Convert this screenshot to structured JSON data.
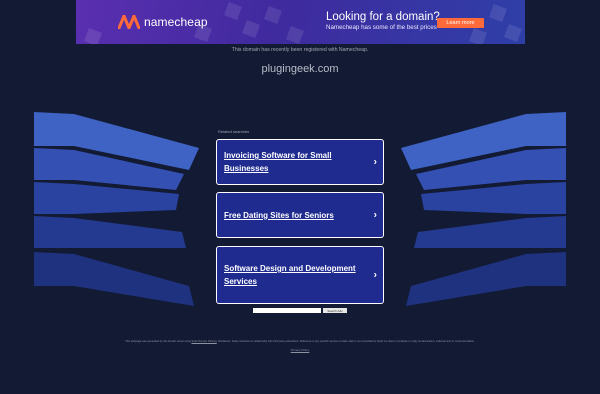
{
  "banner": {
    "brand": "namecheap",
    "title": "Looking for a domain?",
    "subtitle": "Namecheap has some of the best prices",
    "button_label": "Learn more",
    "brand_color": "#ff6a3a"
  },
  "notice": "This domain has recently been registered with Namecheap.",
  "domain": "plugingeek.com",
  "related_label": "Related searches",
  "searches": [
    {
      "label": "Invoicing Software for Small Businesses"
    },
    {
      "label": "Free Dating Sites for Seniors"
    },
    {
      "label": "Software Design and Development Services"
    }
  ],
  "search": {
    "button_label": "Search Ads",
    "placeholder": ""
  },
  "footer": {
    "pre": "This webpage was generated by the domain owner using ",
    "link": "Sedo Domain Parking",
    "post": ". Disclaimer: Sedo maintains no relationship with third party advertisers. Reference to any specific service or trade mark is not controlled by Sedo nor does it constitute or imply its association, endorsement or recommendation.",
    "privacy": "Privacy Policy"
  },
  "icons": {
    "chevron": "chevron-right-icon",
    "logo": "namecheap-logo-icon"
  }
}
